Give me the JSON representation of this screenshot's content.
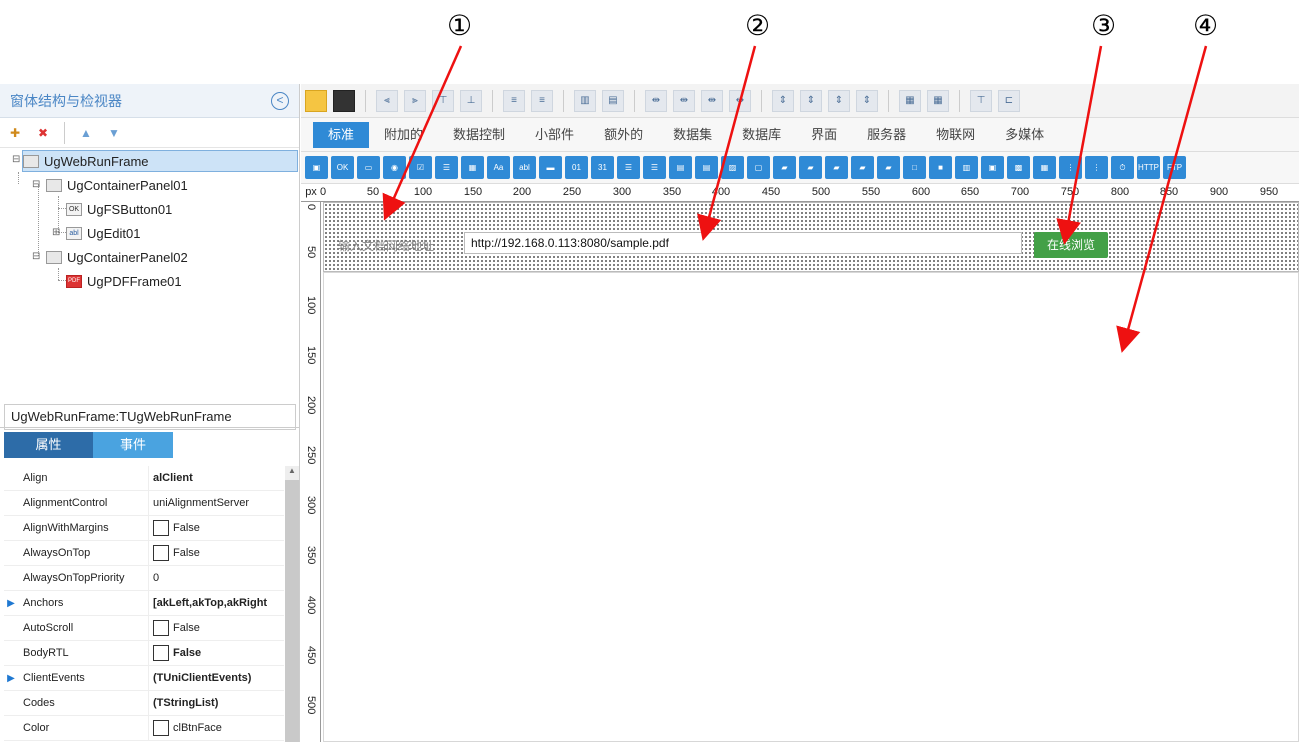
{
  "annotations": [
    "①",
    "②",
    "③",
    "④"
  ],
  "left_panel": {
    "title": "窗体结构与检视器",
    "tree": [
      {
        "label": "UgWebRunFrame"
      },
      {
        "label": "UgContainerPanel01"
      },
      {
        "label": "UgFSButton01"
      },
      {
        "label": "UgEdit01"
      },
      {
        "label": "UgContainerPanel02"
      },
      {
        "label": "UgPDFFrame01"
      }
    ]
  },
  "inspector": {
    "title": "UgWebRunFrame:TUgWebRunFrame",
    "tab_properties": "属性",
    "tab_events": "事件",
    "properties": [
      {
        "name": "Align",
        "value": "alClient"
      },
      {
        "name": "AlignmentControl",
        "value": "uniAlignmentServer"
      },
      {
        "name": "AlignWithMargins",
        "value": "False"
      },
      {
        "name": "AlwaysOnTop",
        "value": "False"
      },
      {
        "name": "AlwaysOnTopPriority",
        "value": "0"
      },
      {
        "name": "Anchors",
        "value": "[akLeft,akTop,akRight"
      },
      {
        "name": "AutoScroll",
        "value": "False"
      },
      {
        "name": "BodyRTL",
        "value": "False"
      },
      {
        "name": "ClientEvents",
        "value": "(TUniClientEvents)"
      },
      {
        "name": "Codes",
        "value": "(TStringList)"
      },
      {
        "name": "Color",
        "value": "clBtnFace"
      }
    ]
  },
  "component_tabs": [
    "标准",
    "附加的",
    "数据控制",
    "小部件",
    "额外的",
    "数据集",
    "数据库",
    "界面",
    "服务器",
    "物联网",
    "多媒体"
  ],
  "ruler": {
    "unit": "px",
    "h_labels": [
      "0",
      "50",
      "100",
      "150",
      "200",
      "250",
      "300",
      "350",
      "400",
      "450",
      "500",
      "550",
      "600",
      "650",
      "700",
      "750",
      "800",
      "850",
      "900",
      "950"
    ],
    "v_labels": [
      "0",
      "50",
      "100",
      "150",
      "200",
      "250",
      "300",
      "350",
      "400",
      "450",
      "500"
    ]
  },
  "form": {
    "edit_label": "输入文档网络地址",
    "edit_value": "http://192.168.0.113:8080/sample.pdf",
    "button_label": "在线浏览"
  }
}
